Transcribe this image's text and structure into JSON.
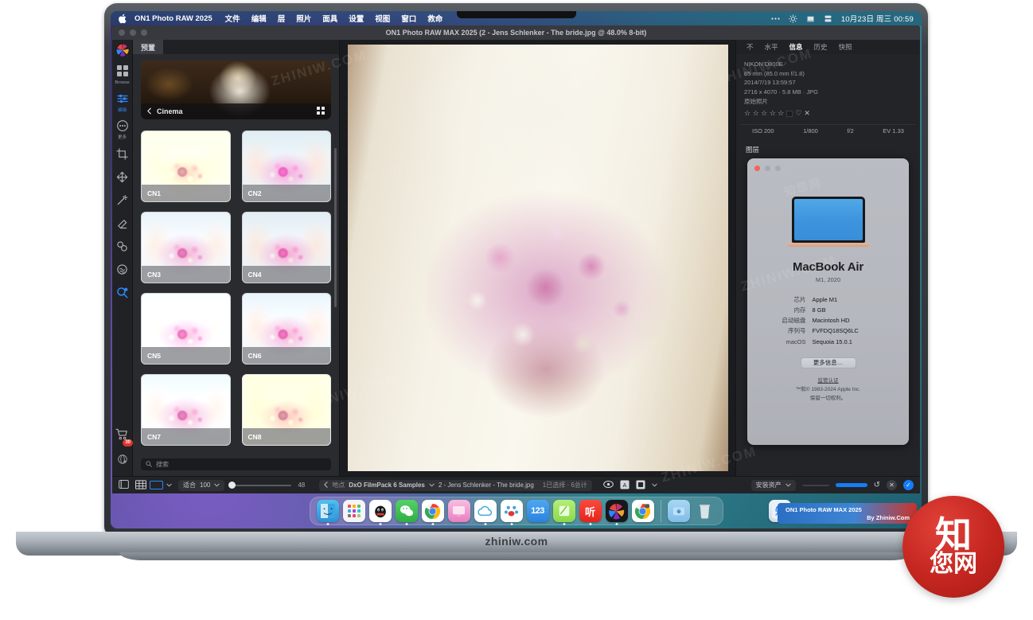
{
  "menubar": {
    "apple_icon": "apple-logo",
    "app_name": "ON1 Photo RAW 2025",
    "items": [
      "文件",
      "编辑",
      "层",
      "照片",
      "面具",
      "设置",
      "视图",
      "窗口",
      "救命"
    ],
    "status_icons": [
      "ellipsis-icon",
      "brightness-icon",
      "notification-icon",
      "display-icon"
    ],
    "clock": "10月23日 周三  00:59"
  },
  "app_window": {
    "title": "ON1 Photo RAW MAX 2025 (2 - Jens Schlenker - The bride.jpg @ 48.0% 8-bit)"
  },
  "rail": {
    "logo": "on1-logo-icon",
    "items": [
      {
        "icon": "grid-browse-icon",
        "label": "Browse",
        "active": false
      },
      {
        "icon": "sliders-edit-icon",
        "label": "编辑",
        "active": true
      },
      {
        "icon": "more-dots-icon",
        "label": "更多",
        "active": false
      }
    ],
    "tools": [
      {
        "icon": "crop-icon"
      },
      {
        "icon": "move-icon"
      },
      {
        "icon": "retouch-wand-icon"
      },
      {
        "icon": "eraser-icon"
      },
      {
        "icon": "blend-circles-icon"
      },
      {
        "icon": "brain-ai-icon"
      },
      {
        "icon": "magnifier-ai-icon",
        "active": true
      }
    ],
    "cart": {
      "icon": "cart-icon",
      "badge": "30"
    },
    "extra": {
      "icon": "sphere-icon"
    }
  },
  "presets": {
    "tab_label": "预置",
    "category": {
      "name": "Cinema",
      "back_icon": "chevron-left-icon",
      "grid_icon": "grid-view-icon"
    },
    "thumbnails": [
      {
        "label": "CN1",
        "variant": "v1",
        "selected": false
      },
      {
        "label": "CN2",
        "variant": "v2",
        "selected": false
      },
      {
        "label": "CN3",
        "variant": "v3",
        "selected": false
      },
      {
        "label": "CN4",
        "variant": "v4",
        "selected": false
      },
      {
        "label": "CN5",
        "variant": "v5",
        "selected": false
      },
      {
        "label": "CN6",
        "variant": "v6",
        "selected": false
      },
      {
        "label": "CN7",
        "variant": "v7",
        "selected": false
      },
      {
        "label": "CN8",
        "variant": "v8",
        "selected": true
      }
    ],
    "search_placeholder": "搜索",
    "search_value": ""
  },
  "right_panel": {
    "tabs": [
      {
        "label": "不",
        "active": false
      },
      {
        "label": "水平",
        "active": false
      },
      {
        "label": "信息",
        "active": true
      },
      {
        "label": "历史",
        "active": false
      },
      {
        "label": "快照",
        "active": false
      }
    ],
    "metadata": {
      "camera": "NIKON D800E",
      "lens": "85 mm (85.0 mm f/1.8)",
      "datetime": "2014/7/19  13:59:57",
      "dimensions": "2716 x 4070 · 5.8 MB · JPG",
      "source": "原始照片",
      "rating_stars": "☆ ☆ ☆ ☆ ☆",
      "color_label_icon": "color-label-icon",
      "like_icon": "heart-icon",
      "reject_icon": "reject-x-icon"
    },
    "exif": {
      "iso": "ISO 200",
      "shutter": "1/800",
      "aperture": "f/2",
      "ev": "EV 1.33"
    },
    "layers_label": "图层"
  },
  "about_mac": {
    "window_controls": [
      "close-red",
      "minimize-gray",
      "zoom-gray"
    ],
    "device_art": "macbook-air-illustration",
    "title": "MacBook Air",
    "subtitle": "M1, 2020",
    "specs": [
      {
        "key": "芯片",
        "value": "Apple M1"
      },
      {
        "key": "内存",
        "value": "8 GB"
      },
      {
        "key": "启动磁盘",
        "value": "Macintosh HD"
      },
      {
        "key": "序列号",
        "value": "FVFDQ18SQ6LC"
      },
      {
        "key": "macOS",
        "value": "Sequoia 15.0.1"
      }
    ],
    "more_button": "更多信息…",
    "regulatory_link": "监管认证",
    "copyright_line1": "™和© 1983-2024 Apple Inc.",
    "copyright_line2": "保留一切权利。"
  },
  "bottom_toolbar": {
    "panel_toggle_icon": "panel-toggle-icon",
    "grid_view_icon": "grid-view-icon",
    "single_view_icon": "single-view-icon",
    "view_chevron_icon": "chevron-down-icon",
    "fit_label": "适合",
    "zoom_value": "100",
    "zoom_chevron_icon": "chevron-down-icon",
    "thumb_size_value": "48",
    "breadcrumb_back_icon": "chevron-left-icon",
    "location_label": "地点",
    "folder_name": "DxO FilmPack 6 Samples",
    "folder_chevron_icon": "chevron-down-icon",
    "file_name": "2 - Jens Schlenker - The bride.jpg",
    "selection_status": "1已选择 · 6总计",
    "preview_icon": "eye-icon",
    "soft_proof_icon": "soft-proof-icon",
    "compare_icon": "compare-icon",
    "compare_chevron_icon": "chevron-down-icon",
    "install_label": "安装资产",
    "install_chevron_icon": "chevron-down-icon",
    "progress_complete": true,
    "reset_icon": "undo-icon",
    "cancel_icon": "close-x-icon",
    "done_icon": "check-icon"
  },
  "dock": {
    "items": [
      {
        "name": "finder-icon",
        "glyph": "",
        "bg": "#2b9fe0",
        "running": true
      },
      {
        "name": "launchpad-icon",
        "glyph": "",
        "bg": "#f2f3f5",
        "running": false
      },
      {
        "name": "qq-icon",
        "glyph": "",
        "bg": "#ffffff",
        "running": true
      },
      {
        "name": "wechat-icon",
        "glyph": "",
        "bg": "#3eb34f",
        "running": true
      },
      {
        "name": "chrome-icon",
        "glyph": "",
        "bg": "#ffffff",
        "running": true
      },
      {
        "name": "screen-share-icon",
        "glyph": "",
        "bg": "#f2aed6",
        "running": false
      },
      {
        "name": "icloud-drive-icon",
        "glyph": "",
        "bg": "#ffffff",
        "running": true
      },
      {
        "name": "baidu-netdisk-icon",
        "glyph": "",
        "bg": "#ffffff",
        "running": true
      },
      {
        "name": "123-pan-icon",
        "glyph": "123",
        "bg": "#2f96ec",
        "running": false
      },
      {
        "name": "notes-icon",
        "glyph": "",
        "bg": "#8ede5a",
        "running": true
      },
      {
        "name": "ting-icon",
        "glyph": "听",
        "bg": "#f4281f",
        "running": true
      },
      {
        "name": "on1-photo-raw-icon",
        "glyph": "",
        "bg": "#1d1d22",
        "running": true
      },
      {
        "name": "chrome-canary-icon",
        "glyph": "",
        "bg": "#ffffff",
        "running": false
      }
    ],
    "downloads_icon": "downloads-folder-icon",
    "trash_icon": "trash-icon",
    "extra_icon": "zhiniw-app-icon"
  },
  "promo": {
    "line1": "ON1 Photo RAW MAX 2025",
    "line2": "By Zhiniw.Com"
  },
  "branding": {
    "site": "zhiniw.com",
    "seal_top": "知",
    "seal_bottom": "您网",
    "watermark": "ZHINIW.COM"
  },
  "colors": {
    "accent_blue": "#157cf6",
    "badge_red": "#e0342c",
    "panel_bg": "#2a2b2f",
    "app_bg": "#1b1c1f"
  }
}
